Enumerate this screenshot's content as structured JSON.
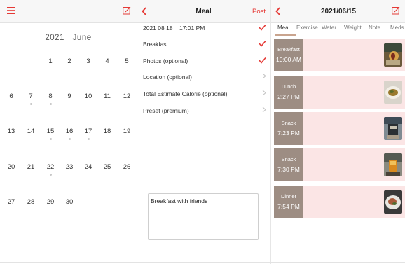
{
  "left_panel": {
    "year": "2021",
    "month": "June",
    "weeks": [
      [
        "",
        "",
        "1",
        "2",
        "3",
        "4",
        "5"
      ],
      [
        "6",
        "7",
        "8",
        "9",
        "10",
        "11",
        "12"
      ],
      [
        "13",
        "14",
        "15",
        "16",
        "17",
        "18",
        "19"
      ],
      [
        "20",
        "21",
        "22",
        "23",
        "24",
        "25",
        "26"
      ],
      [
        "27",
        "28",
        "29",
        "30",
        "",
        "",
        ""
      ]
    ],
    "days_with_entries": [
      "7",
      "8",
      "15",
      "16",
      "17",
      "22"
    ]
  },
  "middle_panel": {
    "title": "Meal",
    "post_label": "Post",
    "rows": {
      "datetime": "2021 08 18    17:01 PM",
      "breakfast": "Breakfast",
      "photos": "Photos (optional)",
      "location": "Location (optional)",
      "calorie": "Total Estimate Calorie (optional)",
      "preset": "Preset (premium)"
    },
    "note_text": "Breakfast with friends"
  },
  "right_panel": {
    "date": "2021/06/15",
    "tabs": {
      "meal": "Meal",
      "exercise": "Exercise",
      "water": "Water",
      "weight": "Weight",
      "note": "Note",
      "meds": "Meds"
    },
    "entries": [
      {
        "category": "Breakfast",
        "time": "10:00 AM"
      },
      {
        "category": "Lunch",
        "time": "2:27 PM"
      },
      {
        "category": "Snack",
        "time": "7:23 PM"
      },
      {
        "category": "Snack",
        "time": "7:30 PM"
      },
      {
        "category": "Dinner",
        "time": "7:54 PM"
      }
    ]
  },
  "colors": {
    "accent": "#e53935",
    "card_bg": "#fbe5e5",
    "card_side": "#9d8d83",
    "tab_underline": "#c9a48e"
  }
}
